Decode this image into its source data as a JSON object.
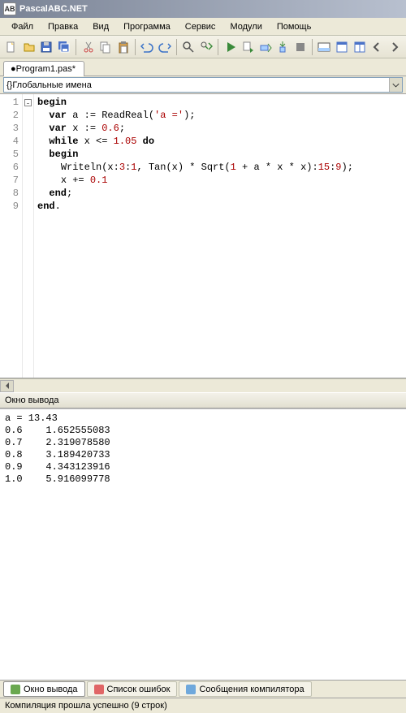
{
  "app": {
    "title": "PascalABC.NET"
  },
  "menu": [
    "Файл",
    "Правка",
    "Вид",
    "Программа",
    "Сервис",
    "Модули",
    "Помощь"
  ],
  "toolbar_icons": [
    "new-file-icon",
    "open-file-icon",
    "save-icon",
    "save-all-icon",
    "sep",
    "cut-icon",
    "copy-icon",
    "paste-icon",
    "sep",
    "undo-icon",
    "redo-icon",
    "sep",
    "find-icon",
    "find-next-icon",
    "sep",
    "run-icon",
    "debug-icon",
    "step-over-icon",
    "step-into-icon",
    "stop-icon",
    "sep",
    "toggle-output-icon",
    "window-1-icon",
    "window-2-icon",
    "prev-icon",
    "next-icon"
  ],
  "tab": {
    "label": "●Program1.pas*"
  },
  "scope_combo": {
    "label": "{}Глобальные имена"
  },
  "code": {
    "lines": [
      {
        "n": "1",
        "ind": 0,
        "tokens": [
          {
            "t": "begin",
            "c": "kw"
          }
        ]
      },
      {
        "n": "2",
        "ind": 1,
        "tokens": [
          {
            "t": "var",
            "c": "kw"
          },
          {
            "t": " a := ReadReal("
          },
          {
            "t": "'a ='",
            "c": "str"
          },
          {
            "t": ");"
          }
        ]
      },
      {
        "n": "3",
        "ind": 1,
        "tokens": [
          {
            "t": "var",
            "c": "kw"
          },
          {
            "t": " x := "
          },
          {
            "t": "0.6",
            "c": "num"
          },
          {
            "t": ";"
          }
        ]
      },
      {
        "n": "4",
        "ind": 1,
        "tokens": [
          {
            "t": "while",
            "c": "kw"
          },
          {
            "t": " x <= "
          },
          {
            "t": "1.05",
            "c": "num"
          },
          {
            "t": " "
          },
          {
            "t": "do",
            "c": "kw"
          }
        ]
      },
      {
        "n": "5",
        "ind": 1,
        "tokens": [
          {
            "t": "begin",
            "c": "kw"
          }
        ]
      },
      {
        "n": "6",
        "ind": 2,
        "tokens": [
          {
            "t": "Writeln(x:"
          },
          {
            "t": "3",
            "c": "num"
          },
          {
            "t": ":"
          },
          {
            "t": "1",
            "c": "num"
          },
          {
            "t": ", Tan(x) * Sqrt("
          },
          {
            "t": "1",
            "c": "num"
          },
          {
            "t": " + a * x * x):"
          },
          {
            "t": "15",
            "c": "num"
          },
          {
            "t": ":"
          },
          {
            "t": "9",
            "c": "num"
          },
          {
            "t": ");"
          }
        ]
      },
      {
        "n": "7",
        "ind": 2,
        "tokens": [
          {
            "t": "x += "
          },
          {
            "t": "0.1",
            "c": "num"
          }
        ]
      },
      {
        "n": "8",
        "ind": 1,
        "tokens": [
          {
            "t": "end",
            "c": "kw"
          },
          {
            "t": ";"
          }
        ]
      },
      {
        "n": "9",
        "ind": 0,
        "tokens": [
          {
            "t": "end",
            "c": "kw"
          },
          {
            "t": "."
          }
        ]
      }
    ]
  },
  "output": {
    "title": "Окно вывода",
    "lines": [
      "a = 13.43",
      "0.6    1.652555083",
      "0.7    2.319078580",
      "0.8    3.189420733",
      "0.9    4.343123916",
      "1.0    5.916099778"
    ]
  },
  "bottom_tabs": [
    {
      "label": "Окно вывода",
      "active": true,
      "icon": "output-tab-icon",
      "color": "#6aa84f"
    },
    {
      "label": "Список ошибок",
      "active": false,
      "icon": "errors-tab-icon",
      "color": "#e06666"
    },
    {
      "label": "Сообщения компилятора",
      "active": false,
      "icon": "messages-tab-icon",
      "color": "#6fa8dc"
    }
  ],
  "status": {
    "text": "Компиляция прошла успешно (9 строк)"
  }
}
